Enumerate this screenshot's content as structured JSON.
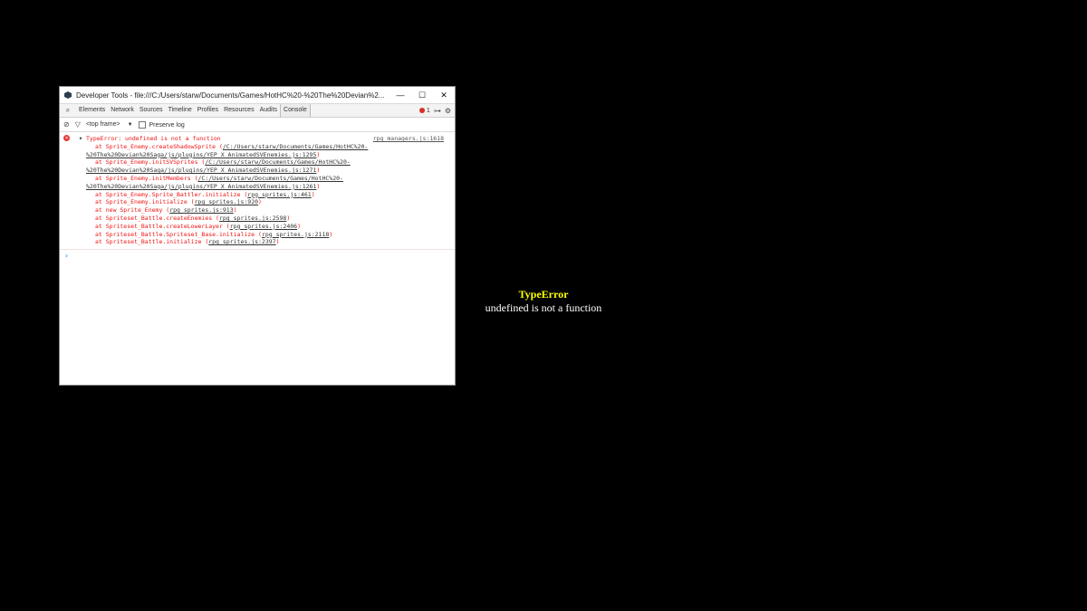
{
  "window": {
    "title": "Developer Tools - file:///C:/Users/starw/Documents/Games/HotHC%20-%20The%20Devian%2...",
    "minimize_glyph": "—",
    "maximize_glyph": "☐",
    "close_glyph": "✕"
  },
  "tabs": [
    "Elements",
    "Network",
    "Sources",
    "Timeline",
    "Profiles",
    "Resources",
    "Audits",
    "Console"
  ],
  "active_tab": "Console",
  "error_count": "1",
  "toolbar": {
    "frame_label": "<top frame>",
    "frame_caret": "▼",
    "preserve_log": "Preserve log"
  },
  "error": {
    "message": "TypeError: undefined is not a function",
    "source": "rpg_managers.js:1618",
    "stack": [
      [
        "at Sprite_Enemy.createShadowSprite (",
        "/C:/Users/starw/Documents/Games/HotHC%20-",
        ""
      ],
      [
        "",
        "%20The%20Devian%20Saga/js/plugins/YEP_X_AnimatedSVEnemies.js:1295",
        ")"
      ],
      [
        "at Sprite_Enemy.initSVSprites (",
        "/C:/Users/starw/Documents/Games/HotHC%20-",
        ""
      ],
      [
        "",
        "%20The%20Devian%20Saga/js/plugins/YEP_X_AnimatedSVEnemies.js:1271",
        ")"
      ],
      [
        "at Sprite_Enemy.initMembers (",
        "/C:/Users/starw/Documents/Games/HotHC%20-",
        ""
      ],
      [
        "",
        "%20The%20Devian%20Saga/js/plugins/YEP_X_AnimatedSVEnemies.js:1261",
        ")"
      ],
      [
        "at Sprite_Enemy.Sprite_Battler.initialize (",
        "rpg_sprites.js:461",
        ")"
      ],
      [
        "at Sprite_Enemy.initialize (",
        "rpg_sprites.js:920",
        ")"
      ],
      [
        "at new Sprite_Enemy (",
        "rpg_sprites.js:913",
        ")"
      ],
      [
        "at Spriteset_Battle.createEnemies (",
        "rpg_sprites.js:2598",
        ")"
      ],
      [
        "at Spriteset_Battle.createLowerLayer (",
        "rpg_sprites.js:2406",
        ")"
      ],
      [
        "at Spriteset_Battle.Spriteset_Base.initialize (",
        "rpg_sprites.js:2118",
        ")"
      ],
      [
        "at Spriteset_Battle.initialize (",
        "rpg_sprites.js:2397",
        ")"
      ]
    ]
  },
  "prompt": "›",
  "game_error": {
    "title": "TypeError",
    "message": "undefined is not a function"
  },
  "colors": {
    "error_red": "#e11111",
    "error_title_yellow": "#ffff00",
    "background": "#000000"
  },
  "icons": [
    "app-icon",
    "search-icon",
    "error-badge-icon",
    "drawer-icon",
    "gear-icon",
    "clear-icon",
    "filter-icon",
    "expand-triangle-icon",
    "error-icon",
    "prompt-icon"
  ]
}
